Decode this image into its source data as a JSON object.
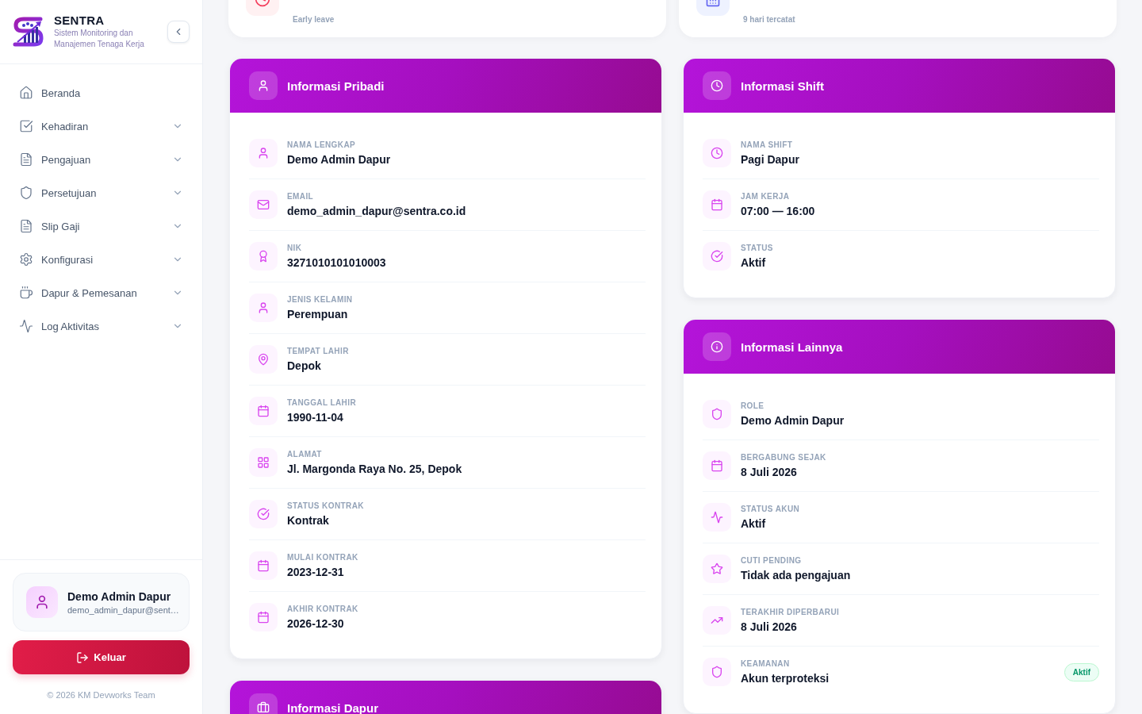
{
  "sidebar": {
    "brand": {
      "name": "SENTRA",
      "tagline": "Sistem Monitoring dan Manajemen Tenaga Kerja"
    },
    "nav": [
      {
        "label": "Beranda",
        "kind": "link",
        "selected": false
      },
      {
        "label": "Kehadiran",
        "kind": "group",
        "selected": false
      },
      {
        "label": "Pengajuan",
        "kind": "group",
        "selected": false
      },
      {
        "label": "Persetujuan",
        "kind": "group",
        "selected": false
      },
      {
        "label": "Slip Gaji",
        "kind": "group",
        "selected": false
      },
      {
        "label": "Konfigurasi",
        "kind": "group",
        "selected": false
      },
      {
        "label": "Dapur & Pemesanan",
        "kind": "group",
        "selected": false
      },
      {
        "label": "Log Aktivitas",
        "kind": "group",
        "selected": false
      }
    ],
    "user": {
      "name": "Demo Admin Dapur",
      "email": "demo_admin_dapur@sent…"
    },
    "logout_button": "Keluar",
    "footer": "© 2026 KM Devworks Team"
  },
  "stats": [
    {
      "label": "Early leave"
    },
    {
      "label": "9 hari tercatat"
    }
  ],
  "personal_info": {
    "title": "Informasi Pribadi",
    "rows": [
      {
        "label": "NAMA LENGKAP",
        "value": "Demo Admin Dapur"
      },
      {
        "label": "EMAIL",
        "value": "demo_admin_dapur@sentra.co.id"
      },
      {
        "label": "NIK",
        "value": "3271010101010003"
      },
      {
        "label": "JENIS KELAMIN",
        "value": "Perempuan"
      },
      {
        "label": "TEMPAT LAHIR",
        "value": "Depok"
      },
      {
        "label": "TANGGAL LAHIR",
        "value": "1990-11-04"
      },
      {
        "label": "ALAMAT",
        "value": "Jl. Margonda Raya No. 25, Depok"
      },
      {
        "label": "STATUS KONTRAK",
        "value": "Kontrak"
      },
      {
        "label": "MULAI KONTRAK",
        "value": "2023-12-31"
      },
      {
        "label": "AKHIR KONTRAK",
        "value": "2026-12-30"
      }
    ]
  },
  "kitchen_info": {
    "title": "Informasi Dapur"
  },
  "shift_info": {
    "title": "Informasi Shift",
    "rows": [
      {
        "label": "NAMA SHIFT",
        "value": "Pagi Dapur"
      },
      {
        "label": "JAM KERJA",
        "value": "07:00 — 16:00"
      },
      {
        "label": "STATUS",
        "value": "Aktif"
      }
    ]
  },
  "other_info": {
    "title": "Informasi Lainnya",
    "rows": [
      {
        "label": "ROLE",
        "value": "Demo Admin Dapur"
      },
      {
        "label": "BERGABUNG SEJAK",
        "value": "8 Juli 2026"
      },
      {
        "label": "STATUS AKUN",
        "value": "Aktif"
      },
      {
        "label": "CUTI PENDING",
        "value": "Tidak ada pengajuan"
      },
      {
        "label": "TERAKHIR DIPERBARUI",
        "value": "8 Juli 2026"
      },
      {
        "label": "KEAMANAN",
        "value": "Akun terproteksi",
        "badge": "Aktif"
      }
    ]
  }
}
